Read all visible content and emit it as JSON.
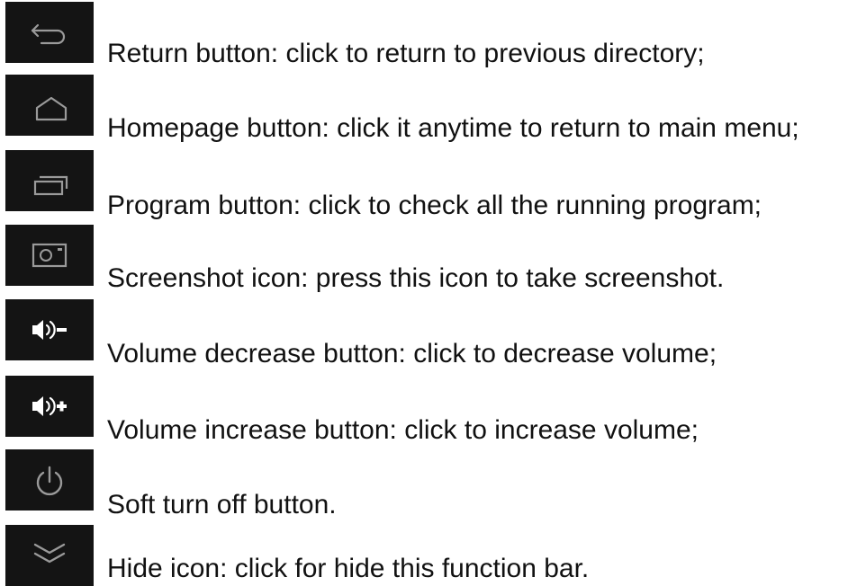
{
  "items": [
    {
      "icon": "return-icon",
      "text": "Return button: click to return to previous directory;"
    },
    {
      "icon": "home-icon",
      "text": "Homepage button: click it anytime to return to main menu;"
    },
    {
      "icon": "recent-apps-icon",
      "text": "Program button: click to check all the running program;"
    },
    {
      "icon": "screenshot-icon",
      "text": "Screenshot icon: press this icon to take screenshot."
    },
    {
      "icon": "volume-down-icon",
      "text": "Volume decrease button: click to decrease volume;"
    },
    {
      "icon": "volume-up-icon",
      "text": "Volume increase button: click to increase volume;"
    },
    {
      "icon": "power-icon",
      "text": "Soft turn off button."
    },
    {
      "icon": "hide-icon",
      "text": "Hide icon: click for hide this function bar."
    }
  ],
  "colors": {
    "tile_background": "#141414",
    "icon_stroke": "#9a9a9a",
    "icon_stroke_bright": "#ffffff",
    "text": "#111111"
  }
}
